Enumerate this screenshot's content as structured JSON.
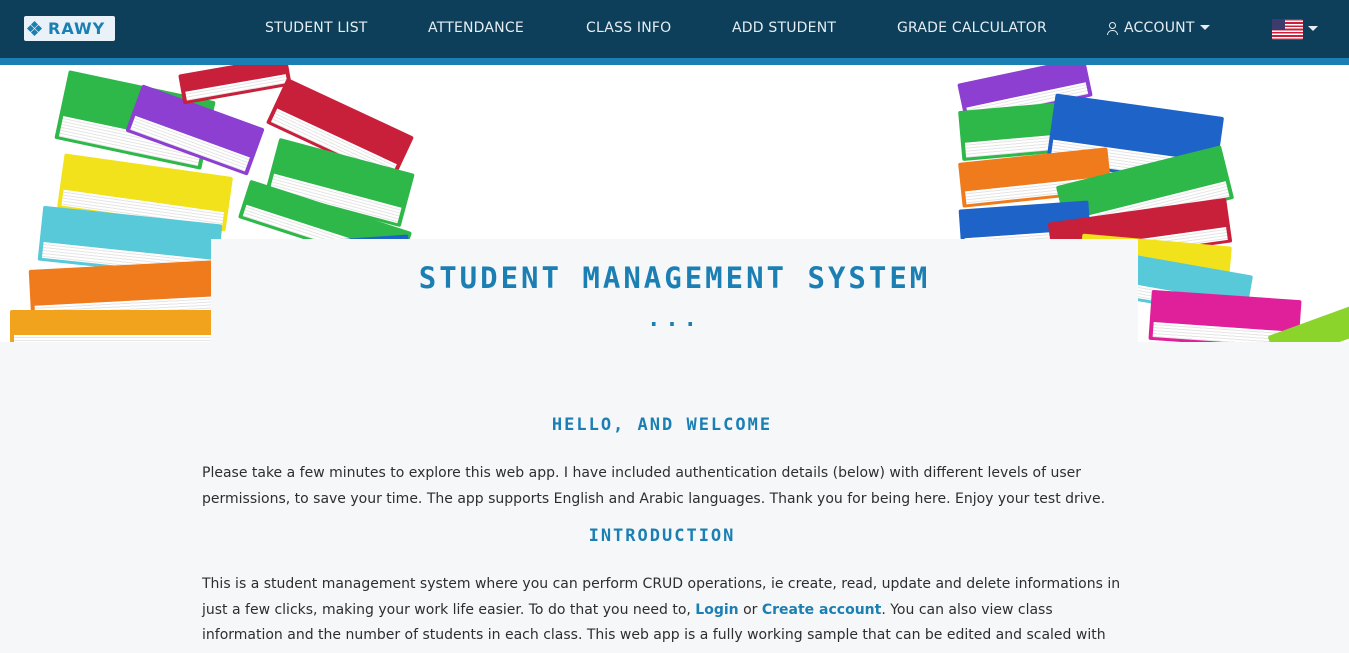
{
  "brand": {
    "name": "RAWY",
    "icon": "diamond-grid-icon"
  },
  "nav": {
    "items": [
      {
        "label": "STUDENT LIST"
      },
      {
        "label": "ATTENDANCE"
      },
      {
        "label": "CLASS INFO"
      },
      {
        "label": "ADD STUDENT"
      },
      {
        "label": "GRADE CALCULATOR"
      }
    ],
    "account_label": "ACCOUNT",
    "account_icon": "user-icon",
    "language_icon": "us-flag-icon"
  },
  "hero": {
    "title": "STUDENT MANAGEMENT SYSTEM",
    "dots": "..."
  },
  "welcome": {
    "heading": "HELLO, AND WELCOME",
    "text": "Please take a few minutes to explore this web app. I have included authentication details (below) with different levels of user permissions, to save your time. The app supports English and Arabic languages. Thank you for being here. Enjoy your test drive."
  },
  "intro": {
    "heading": "INTRODUCTION",
    "text_before": "This is a student management system where you can perform CRUD operations, ie create, read, update and delete informations in just a few clicks, making your work life easier. To do that you need to, ",
    "login_link": "Login",
    "or_text": " or ",
    "create_link": "Create account",
    "text_after": ". You can also view class information and the number of students in each class. This web app is a fully working sample that can be edited and scaled with more features to fit"
  },
  "colors": {
    "navbar": "#0d3f5a",
    "accent": "#1b7fb3",
    "background": "#f5f7f9"
  }
}
